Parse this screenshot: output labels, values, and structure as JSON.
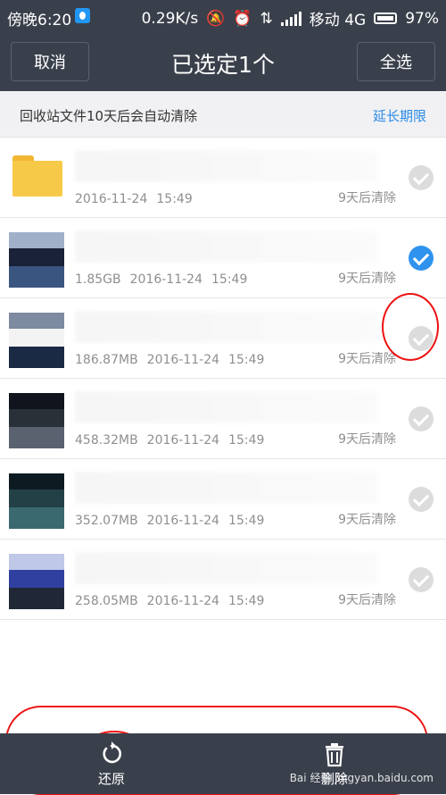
{
  "status_bar": {
    "time": "傍晚6:20",
    "speed": "0.29K/s",
    "carrier": "移动 4G",
    "battery": "97%"
  },
  "header": {
    "cancel_label": "取消",
    "title": "已选定1个",
    "select_all_label": "全选"
  },
  "notice": {
    "message": "回收站文件10天后会自动清除",
    "extend_link": "延长期限"
  },
  "files": [
    {
      "type": "folder",
      "size": "",
      "date": "2016-11-24",
      "time": "15:49",
      "expiry": "9天后清除",
      "selected": false
    },
    {
      "type": "video",
      "size": "1.85GB",
      "date": "2016-11-24",
      "time": "15:49",
      "expiry": "9天后清除",
      "selected": true
    },
    {
      "type": "video",
      "size": "186.87MB",
      "date": "2016-11-24",
      "time": "15:49",
      "expiry": "9天后清除",
      "selected": false
    },
    {
      "type": "video",
      "size": "458.32MB",
      "date": "2016-11-24",
      "time": "15:49",
      "expiry": "9天后清除",
      "selected": false
    },
    {
      "type": "video",
      "size": "352.07MB",
      "date": "2016-11-24",
      "time": "15:49",
      "expiry": "9天后清除",
      "selected": false
    },
    {
      "type": "video",
      "size": "258.05MB",
      "date": "2016-11-24",
      "time": "15:49",
      "expiry": "9天后清除",
      "selected": false
    }
  ],
  "toolbar": {
    "restore_label": "还原",
    "delete_label": "删除",
    "restore_icon": "restore-icon",
    "delete_icon": "trash-icon"
  },
  "watermark": "Bai 经验 jingyan.baidu.com",
  "colors": {
    "bar": "#3a404b",
    "accent": "#2f93ee",
    "folder": "#f7c948",
    "annotation": "#e11111"
  }
}
